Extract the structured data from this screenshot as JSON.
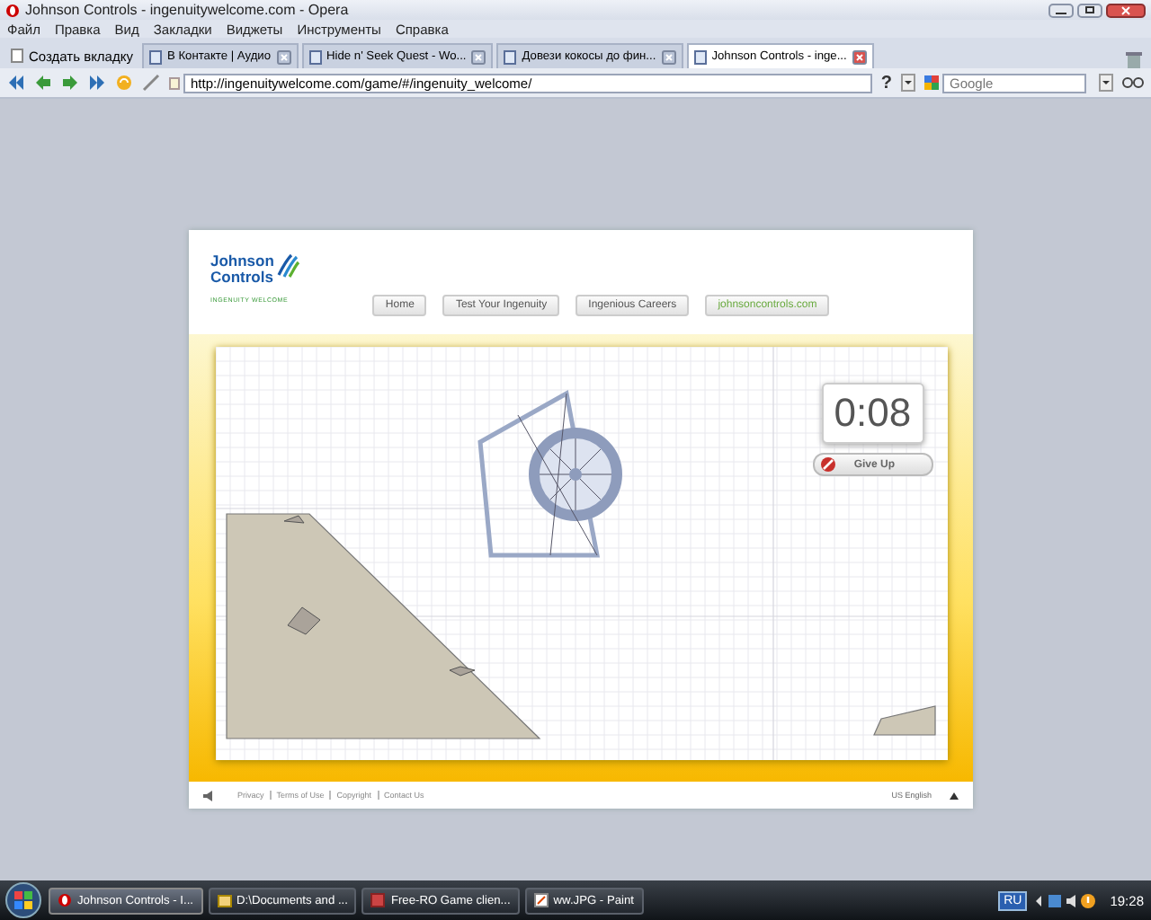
{
  "window": {
    "title": "Johnson Controls - ingenuitywelcome.com - Opera"
  },
  "menu": [
    "Файл",
    "Правка",
    "Вид",
    "Закладки",
    "Виджеты",
    "Инструменты",
    "Справка"
  ],
  "new_tab": "Создать вкладку",
  "tabs": [
    {
      "label": "В Контакте | Аудио",
      "selected": false
    },
    {
      "label": "Hide n' Seek Quest - Wo...",
      "selected": false
    },
    {
      "label": "Довези кокосы до фин...",
      "selected": false
    },
    {
      "label": "Johnson Controls - inge...",
      "selected": true
    }
  ],
  "address": {
    "value": "http://ingenuitywelcome.com/game/#/ingenuity_welcome/"
  },
  "help": "?",
  "search": {
    "placeholder": "Google"
  },
  "site": {
    "logo": {
      "line1": "Johnson",
      "line2": "Controls",
      "tagline": "INGENUITY WELCOME"
    },
    "nav": [
      {
        "label": "Home",
        "kind": "page"
      },
      {
        "label": "Test Your Ingenuity",
        "kind": "page"
      },
      {
        "label": "Ingenious Careers",
        "kind": "page"
      },
      {
        "label": "johnsoncontrols.com",
        "kind": "external"
      }
    ],
    "timer": "0:08",
    "give_up": "Give Up",
    "footer_links": [
      "Privacy",
      "Terms of Use",
      "Copyright",
      "Contact Us"
    ],
    "language": "US English"
  },
  "taskbar": {
    "items": [
      {
        "label": "Johnson Controls - I...",
        "selected": true
      },
      {
        "label": "D:\\Documents and ...",
        "selected": false
      },
      {
        "label": "Free-RO Game clien...",
        "selected": false
      },
      {
        "label": "ww.JPG - Paint",
        "selected": false
      }
    ],
    "language": "RU",
    "clock": "19:28"
  }
}
